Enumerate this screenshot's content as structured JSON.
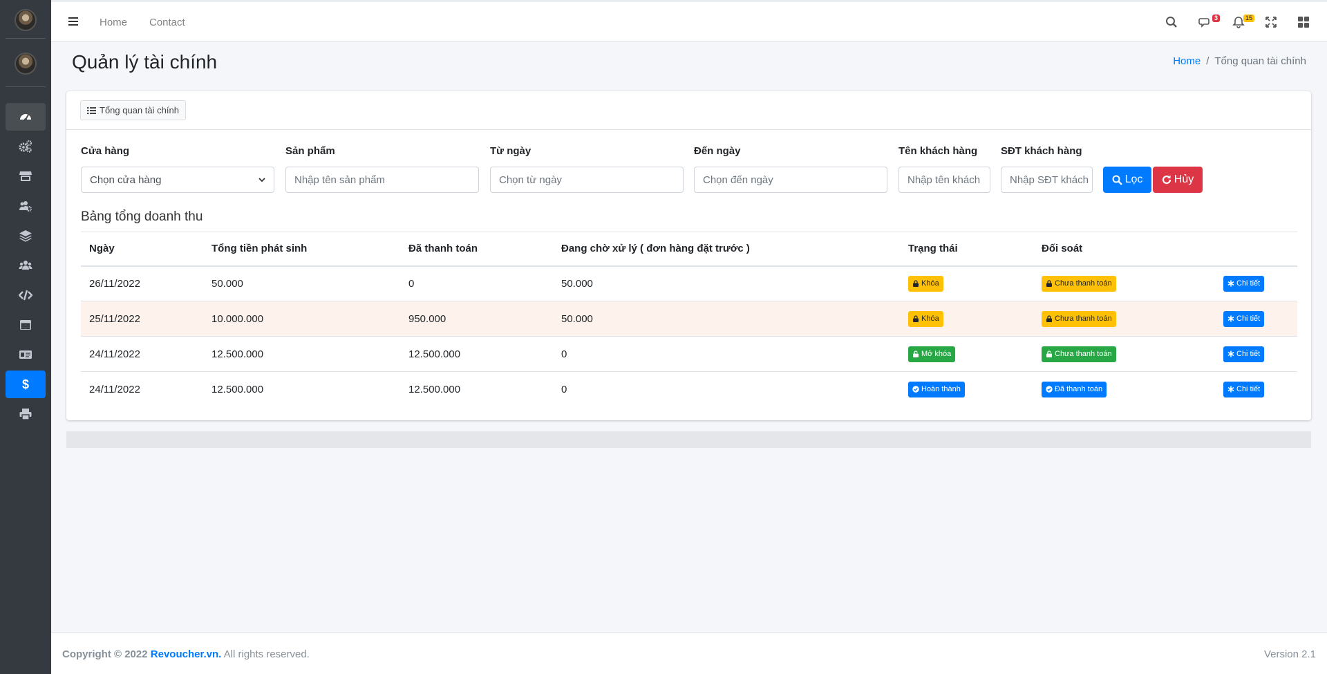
{
  "nav": {
    "home": "Home",
    "contact": "Contact",
    "messages_count": "3",
    "notifications_count": "15"
  },
  "page": {
    "title": "Quản lý tài chính"
  },
  "breadcrumb": {
    "home": "Home",
    "current": "Tổng quan tài chính"
  },
  "tab": {
    "label": "Tổng quan tài chính"
  },
  "filters": {
    "store": {
      "label": "Cửa hàng",
      "value": "Chọn cửa hàng"
    },
    "product": {
      "label": "Sản phẩm",
      "placeholder": "Nhập tên sản phẩm"
    },
    "from_date": {
      "label": "Từ ngày",
      "placeholder": "Chọn từ ngày"
    },
    "to_date": {
      "label": "Đến ngày",
      "placeholder": "Chọn đến ngày"
    },
    "customer_name": {
      "label": "Tên khách hàng",
      "placeholder": "Nhập tên khách"
    },
    "customer_phone": {
      "label": "SĐT khách hàng",
      "placeholder": "Nhập SĐT khách"
    },
    "filter_button": "Lọc",
    "cancel_button": "Hủy"
  },
  "table": {
    "title": "Bảng tổng doanh thu",
    "headers": [
      "Ngày",
      "Tổng tiền phát sinh",
      "Đã thanh toán",
      "Đang chờ xử lý ( đơn hàng đặt trước )",
      "Trạng thái",
      "Đối soát",
      ""
    ],
    "rows": [
      {
        "date": "26/11/2022",
        "total": "50.000",
        "paid": "0",
        "pending": "50.000",
        "status": "Khóa",
        "reconcile": "Chưa thanh toán",
        "detail": "Chi tiết"
      },
      {
        "date": "25/11/2022",
        "total": "10.000.000",
        "paid": "950.000",
        "pending": "50.000",
        "status": "Khóa",
        "reconcile": "Chưa thanh toán",
        "detail": "Chi tiết"
      },
      {
        "date": "24/11/2022",
        "total": "12.500.000",
        "paid": "12.500.000",
        "pending": "0",
        "status": "Mở khóa",
        "reconcile": "Chưa thanh toán",
        "detail": "Chi tiết"
      },
      {
        "date": "24/11/2022",
        "total": "12.500.000",
        "paid": "12.500.000",
        "pending": "0",
        "status": "Hoàn thành",
        "reconcile": "Đã thanh toán",
        "detail": "Chi tiết"
      }
    ]
  },
  "footer": {
    "copyright_prefix": "Copyright © 2022",
    "brand": "Revoucher.vn.",
    "rights": "All rights reserved.",
    "version": "Version 2.1"
  },
  "colors": {
    "sidebar": "#343a40",
    "primary": "#007bff",
    "danger": "#dc3545",
    "warning": "#ffc107",
    "success": "#28a745"
  }
}
